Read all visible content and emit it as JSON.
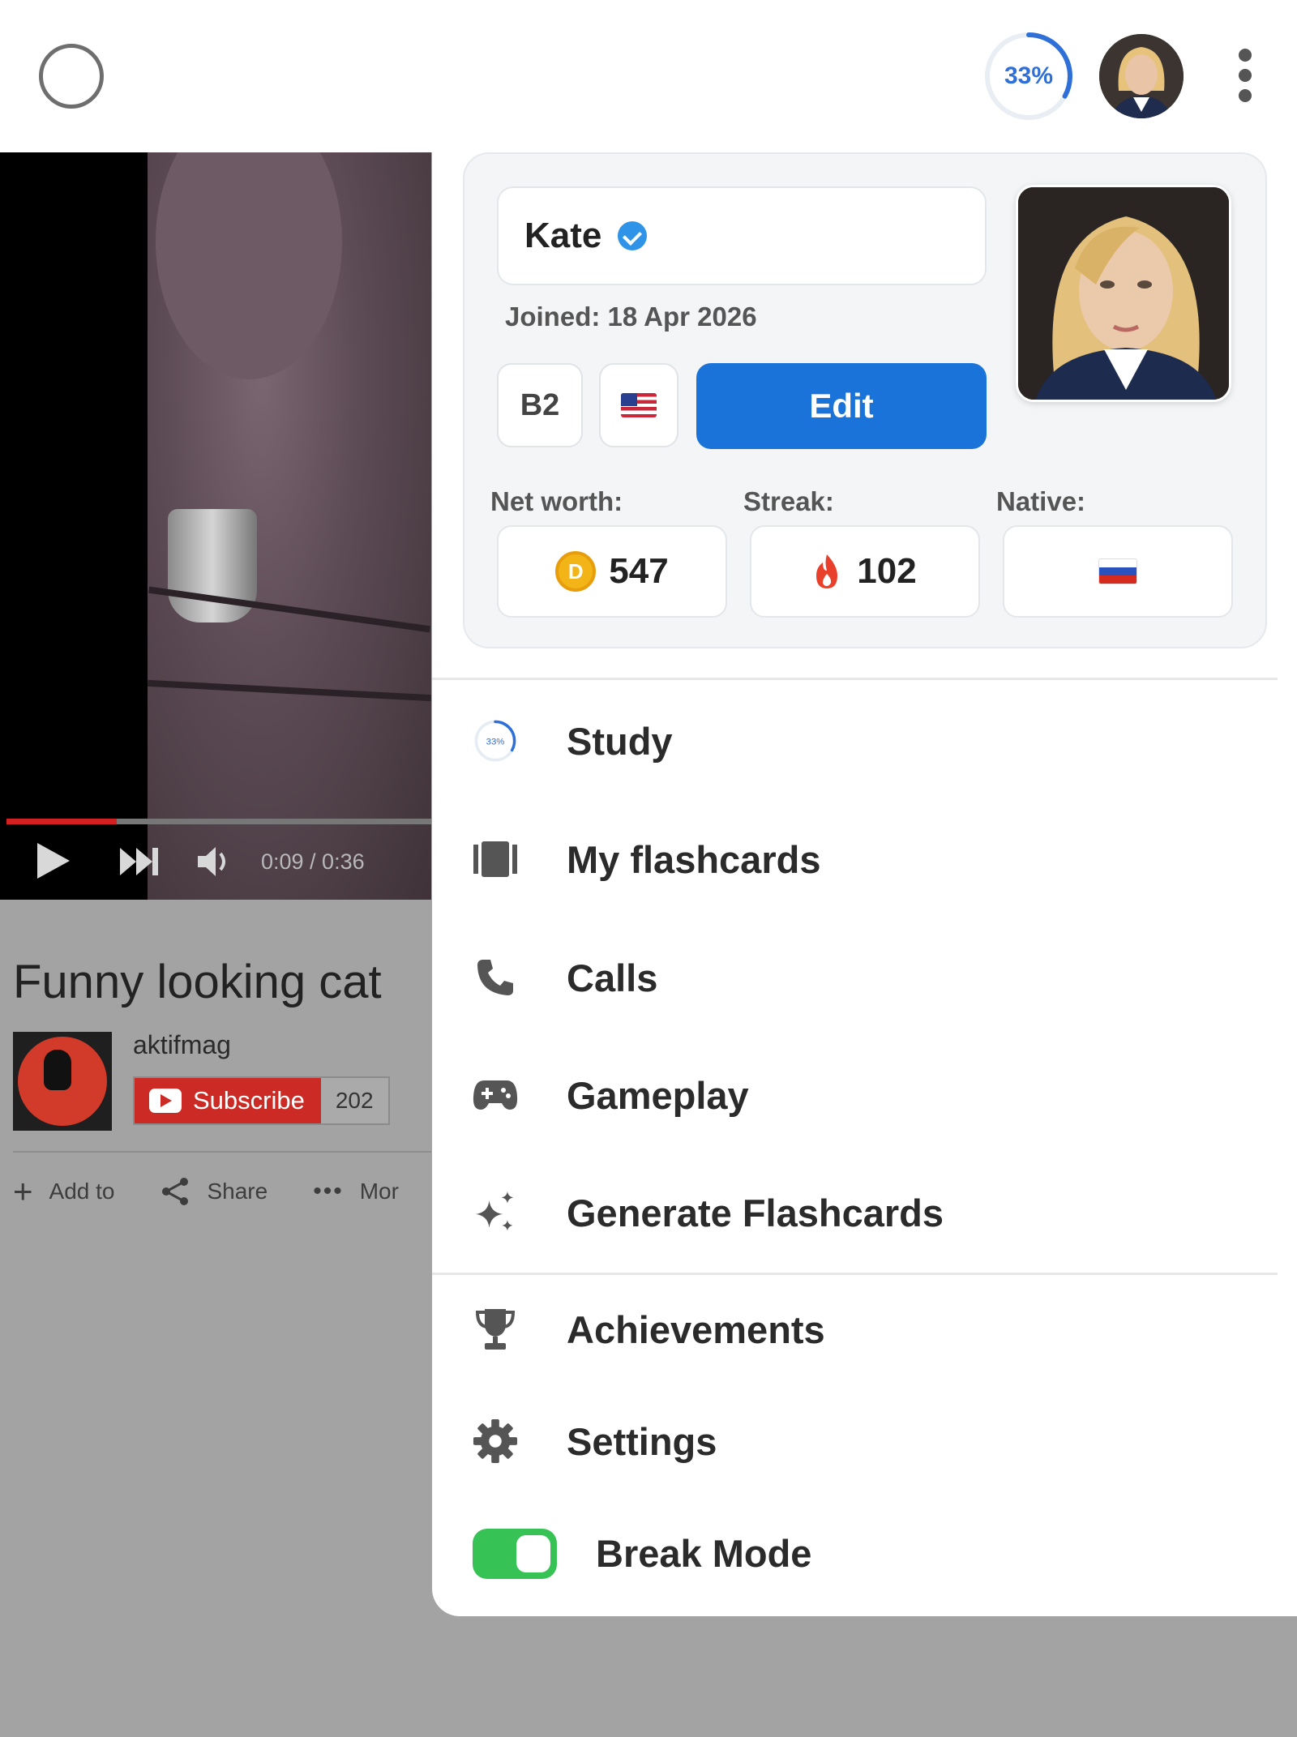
{
  "topbar": {
    "progress_label": "33%",
    "progress_value": 0.33
  },
  "video": {
    "time": "0:09 / 0:36",
    "played_fraction": 0.26,
    "title": "Funny looking cat",
    "channel": "aktifmag",
    "subscribe_label": "Subscribe",
    "subscriber_count": "202",
    "actions": [
      {
        "icon": "plus-icon",
        "label": "Add to"
      },
      {
        "icon": "share-icon",
        "label": "Share"
      },
      {
        "icon": "more-dots-icon",
        "label": "Mor"
      }
    ]
  },
  "profile": {
    "name": "Kate",
    "joined": "Joined: 18 Apr 2026",
    "level": "B2",
    "edit_label": "Edit",
    "net_worth_label": "Net worth:",
    "net_worth": "547",
    "coin_letter": "D",
    "streak_label": "Streak:",
    "streak": "102",
    "native_label": "Native:",
    "learning_flag": "us-flag",
    "native_flag": "ru-flag"
  },
  "menu": {
    "items": [
      {
        "label": "Study",
        "icon": "progress-ring-icon",
        "icon_text": "33%"
      },
      {
        "label": "My flashcards",
        "icon": "flashcards-icon"
      },
      {
        "label": "Calls",
        "icon": "phone-icon"
      },
      {
        "label": "Gameplay",
        "icon": "gamepad-icon"
      },
      {
        "label": "Generate Flashcards",
        "icon": "sparkle-icon"
      },
      {
        "label": "Achievements",
        "icon": "trophy-icon"
      },
      {
        "label": "Settings",
        "icon": "gear-icon"
      }
    ],
    "break_mode_label": "Break Mode",
    "break_mode_on": true
  },
  "colors": {
    "accent": "#1a73d9",
    "toggle_on": "#36c254",
    "subscribe": "#cc2b25"
  }
}
